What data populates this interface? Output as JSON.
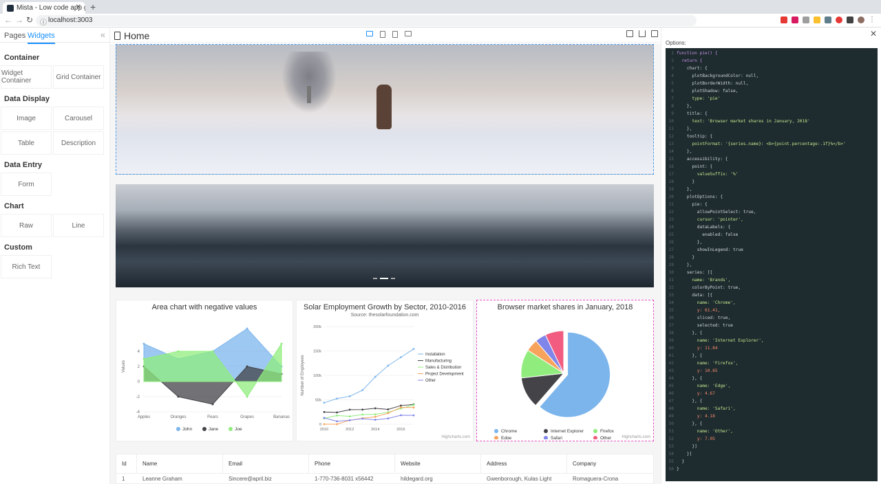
{
  "browser": {
    "tab_title": "Mista - Low code app generator",
    "url": "localhost:3003"
  },
  "sidebar": {
    "tabs": [
      "Pages",
      "Widgets"
    ],
    "groups": [
      {
        "title": "Container",
        "items": [
          "Widget Container",
          "Grid Container"
        ]
      },
      {
        "title": "Data Display",
        "items": [
          "Image",
          "Carousel",
          "Table",
          "Description"
        ]
      },
      {
        "title": "Data Entry",
        "items": [
          "Form"
        ]
      },
      {
        "title": "Chart",
        "items": [
          "Raw",
          "Line"
        ]
      },
      {
        "title": "Custom",
        "items": [
          "Rich Text"
        ]
      }
    ]
  },
  "canvas": {
    "page_title": "Home"
  },
  "charts": {
    "area": {
      "title": "Area chart with negative values",
      "yaxis": "Values",
      "legend": [
        "John",
        "Jane",
        "Joe"
      ]
    },
    "line": {
      "title": "Solar Employment Growth by Sector, 2010-2016",
      "subtitle": "Source: thesolarfoundation.com",
      "yaxis": "Number of Employees",
      "legend": [
        "Installation",
        "Manufacturing",
        "Sales & Distribution",
        "Project Development",
        "Other"
      ],
      "credit": "Highcharts.com"
    },
    "pie": {
      "title": "Browser market shares in January, 2018",
      "legend": [
        "Chrome",
        "Internet Explorer",
        "Firefox",
        "Edge",
        "Safari",
        "Other"
      ],
      "credit": "Highcharts.com"
    }
  },
  "table": {
    "headers": [
      "Id",
      "Name",
      "Email",
      "Phone",
      "Website",
      "Address",
      "Company"
    ],
    "row": [
      "1",
      "Leanne Graham",
      "Sincere@april.biz",
      "1-770-736-8031 x56442",
      "hildegard.org",
      "Gwenborough, Kulas Light",
      "Romaguera-Crona"
    ]
  },
  "options": {
    "label": "Options:"
  },
  "chart_data": [
    {
      "type": "area",
      "title": "Area chart with negative values",
      "categories": [
        "Apples",
        "Oranges",
        "Pears",
        "Grapes",
        "Bananas"
      ],
      "ylabel": "Values",
      "ylim": [
        -4,
        8
      ],
      "series": [
        {
          "name": "John",
          "values": [
            5,
            3,
            4,
            7,
            2
          ]
        },
        {
          "name": "Jane",
          "values": [
            2,
            -2,
            -3,
            2,
            1
          ]
        },
        {
          "name": "Joe",
          "values": [
            3,
            4,
            4,
            -2,
            5
          ]
        }
      ]
    },
    {
      "type": "line",
      "title": "Solar Employment Growth by Sector, 2010-2016",
      "ylabel": "Number of Employees",
      "x": [
        2010,
        2011,
        2012,
        2013,
        2014,
        2015,
        2016,
        2017
      ],
      "ylim": [
        0,
        200000
      ],
      "series": [
        {
          "name": "Installation",
          "values": [
            43934,
            52503,
            57177,
            69658,
            97031,
            119931,
            137133,
            154175
          ]
        },
        {
          "name": "Manufacturing",
          "values": [
            24916,
            24064,
            29742,
            29851,
            32490,
            30282,
            38121,
            40434
          ]
        },
        {
          "name": "Sales & Distribution",
          "values": [
            11744,
            17722,
            16005,
            19771,
            20185,
            24377,
            32147,
            39387
          ]
        },
        {
          "name": "Project Development",
          "values": [
            0,
            0,
            7988,
            12169,
            15112,
            22452,
            34400,
            34227
          ]
        },
        {
          "name": "Other",
          "values": [
            12908,
            5948,
            8105,
            11248,
            8989,
            11816,
            18274,
            18111
          ]
        }
      ]
    },
    {
      "type": "pie",
      "title": "Browser market shares in January, 2018",
      "categories": [
        "Chrome",
        "Internet Explorer",
        "Firefox",
        "Edge",
        "Safari",
        "Other"
      ],
      "values": [
        61.41,
        11.84,
        10.85,
        4.67,
        4.18,
        7.05
      ]
    }
  ],
  "code_lines": [
    "function pie() {",
    "  return {",
    "    chart: {",
    "      plotBackgroundColor: null,",
    "      plotBorderWidth: null,",
    "      plotShadow: false,",
    "      type: 'pie'",
    "    },",
    "    title: {",
    "      text: 'Browser market shares in January, 2018'",
    "    },",
    "    tooltip: {",
    "      pointFormat: '{series.name}: <b>{point.percentage:.1f}%</b>'",
    "    },",
    "    accessibility: {",
    "      point: {",
    "        valueSuffix: '%'",
    "      }",
    "    },",
    "    plotOptions: {",
    "      pie: {",
    "        allowPointSelect: true,",
    "        cursor: 'pointer',",
    "        dataLabels: {",
    "          enabled: false",
    "        },",
    "        showInLegend: true",
    "      }",
    "    },",
    "    series: [{",
    "      name: 'Brands',",
    "      colorByPoint: true,",
    "      data: [{",
    "        name: 'Chrome',",
    "        y: 61.41,",
    "        sliced: true,",
    "        selected: true",
    "      }, {",
    "        name: 'Internet Explorer',",
    "        y: 11.84",
    "      }, {",
    "        name: 'Firefox',",
    "        y: 10.85",
    "      }, {",
    "        name: 'Edge',",
    "        y: 4.67",
    "      }, {",
    "        name: 'Safari',",
    "        y: 4.18",
    "      }, {",
    "        name: 'Other',",
    "        y: 7.05",
    "      }]",
    "    }]",
    "  }",
    "}"
  ]
}
